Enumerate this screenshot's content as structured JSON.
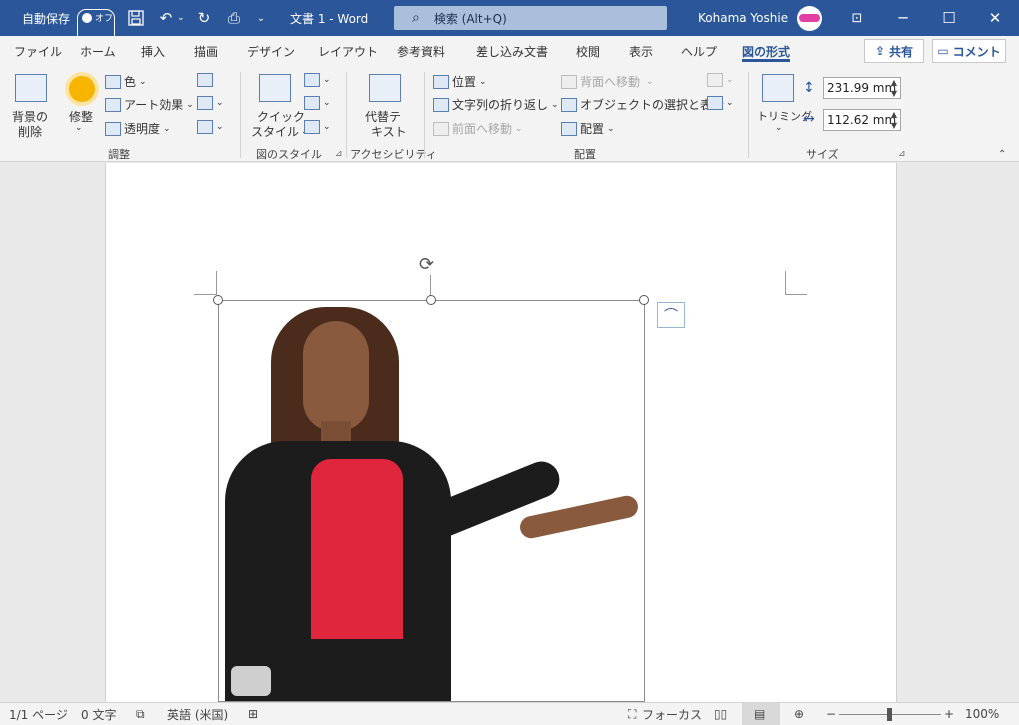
{
  "titlebar": {
    "autosave_label": "自動保存",
    "autosave_state": "オフ",
    "save_icon": "save-icon",
    "undo_icon": "undo-icon",
    "redo_icon": "redo-icon",
    "doc_title": "文書 1  -  Word",
    "search_placeholder": "検索 (Alt+Q)",
    "user_name": "Kohama Yoshie",
    "ribbon_display_icon": "ribbon-display-icon",
    "minimize": "─",
    "maximize": "☐",
    "close": "✕",
    "accent": "#2b579a"
  },
  "tabs": [
    "ファイル",
    "ホーム",
    "挿入",
    "描画",
    "デザイン",
    "レイアウト",
    "参考資料",
    "差し込み文書",
    "校閲",
    "表示",
    "ヘルプ",
    "図の形式"
  ],
  "active_tab": "図の形式",
  "share_label": "共有",
  "comment_label": "コメント",
  "ribbon": {
    "adjust": {
      "remove_bg": [
        "背景の",
        "削除"
      ],
      "corrections": "修整",
      "color": "色",
      "art_effects": "アート効果",
      "transparency": "透明度",
      "label": "調整"
    },
    "styles": {
      "quick_styles": [
        "クイック",
        "スタイル"
      ],
      "label": "図のスタイル"
    },
    "accessibility": {
      "alt_text": [
        "代替テ",
        "キスト"
      ],
      "label": "アクセシビリティ"
    },
    "arrange": {
      "position": "位置",
      "wrap_text": "文字列の折り返し",
      "bring_forward": "前面へ移動",
      "send_backward": "背面へ移動",
      "selection_pane": "オブジェクトの選択と表示",
      "align": "配置",
      "label": "配置"
    },
    "size": {
      "crop": "トリミング",
      "height": "231.99 mm",
      "width": "112.62 mm",
      "label": "サイズ"
    }
  },
  "statusbar": {
    "page": "1/1 ページ",
    "words": "0 文字",
    "language": "英語 (米国)",
    "focus": "フォーカス",
    "zoom": "100%",
    "zoom_minus": "−",
    "zoom_plus": "+"
  }
}
